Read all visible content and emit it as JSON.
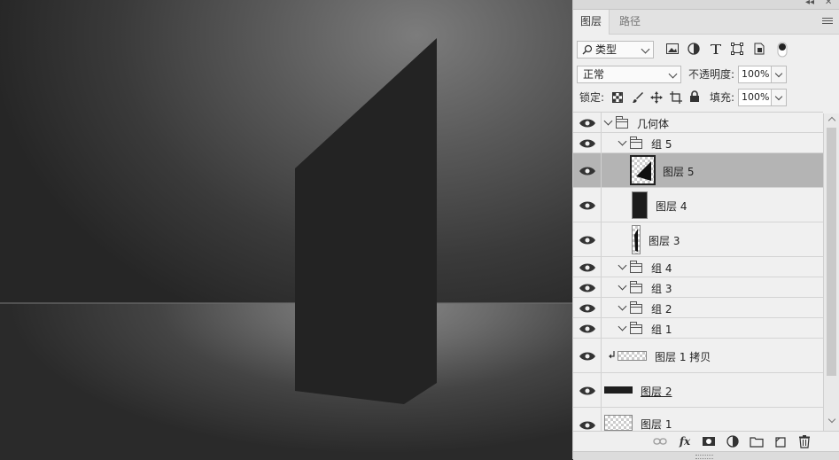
{
  "panel_controls": {
    "collapse": "◂◂",
    "close": "✕"
  },
  "tabs": [
    {
      "label": "图层",
      "active": true
    },
    {
      "label": "路径",
      "active": false
    }
  ],
  "filter": {
    "label": "类型",
    "icons": [
      "image-filter-icon",
      "adjustment-filter-icon",
      "type-filter-icon",
      "shape-filter-icon",
      "smart-object-filter-icon",
      "filter-toggle-icon"
    ]
  },
  "blend": {
    "mode": "正常",
    "opacity_label": "不透明度:",
    "opacity": "100%"
  },
  "lock": {
    "label": "锁定:",
    "fill_label": "填充:",
    "fill": "100%"
  },
  "layers": [
    {
      "name": "几何体",
      "type": "group",
      "depth": 0,
      "expanded": true
    },
    {
      "name": "组 5",
      "type": "group",
      "depth": 1,
      "expanded": true
    },
    {
      "name": "图层 5",
      "type": "layer",
      "depth": 2,
      "selected": true
    },
    {
      "name": "图层 4",
      "type": "layer",
      "depth": 2
    },
    {
      "name": "图层 3",
      "type": "layer",
      "depth": 2
    },
    {
      "name": "组 4",
      "type": "group",
      "depth": 1,
      "expanded": true
    },
    {
      "name": "组 3",
      "type": "group",
      "depth": 1,
      "expanded": true
    },
    {
      "name": "组 2",
      "type": "group",
      "depth": 1,
      "expanded": true
    },
    {
      "name": "组 1",
      "type": "group",
      "depth": 1,
      "expanded": true
    },
    {
      "name": "图层 1 拷贝",
      "type": "layer",
      "clipped": true
    },
    {
      "name": "图层 2",
      "type": "layer"
    },
    {
      "name": "图层 1",
      "type": "layer"
    }
  ],
  "bottom_icons": [
    "link-layers-icon",
    "fx-icon",
    "add-mask-icon",
    "adjustment-layer-icon",
    "new-group-icon",
    "new-layer-icon",
    "delete-layer-icon"
  ],
  "bottom_fx": "fx"
}
